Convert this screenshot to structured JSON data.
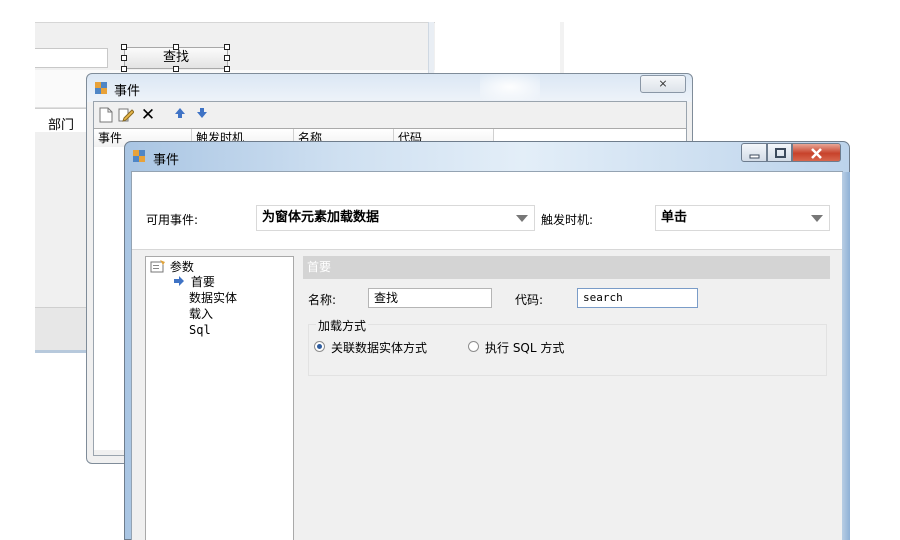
{
  "background": {
    "find_button_label": "查找",
    "dept_column_label": "部门"
  },
  "events_window": {
    "title": "事件",
    "close_glyph": "⨯",
    "toolbar_icons": [
      "new-icon",
      "edit-icon",
      "delete-icon",
      "move-up-icon",
      "move-down-icon"
    ],
    "columns": [
      "事件",
      "触发时机",
      "名称",
      "代码"
    ]
  },
  "event_dialog": {
    "title": "事件",
    "available_events_label": "可用事件:",
    "available_events_value": "为窗体元素加载数据",
    "trigger_label": "触发时机:",
    "trigger_value": "单击",
    "tree": {
      "root": "参数",
      "items": [
        "首要",
        "数据实体",
        "载入",
        "Sql"
      ]
    },
    "section_title": "首要",
    "name_label": "名称:",
    "name_value": "查找",
    "code_label": "代码:",
    "code_value": "search",
    "load_mode_label": "加载方式",
    "radio_entity_label": "关联数据实体方式",
    "radio_sql_label": "执行 SQL 方式",
    "selected_load_mode": "关联数据实体方式"
  }
}
